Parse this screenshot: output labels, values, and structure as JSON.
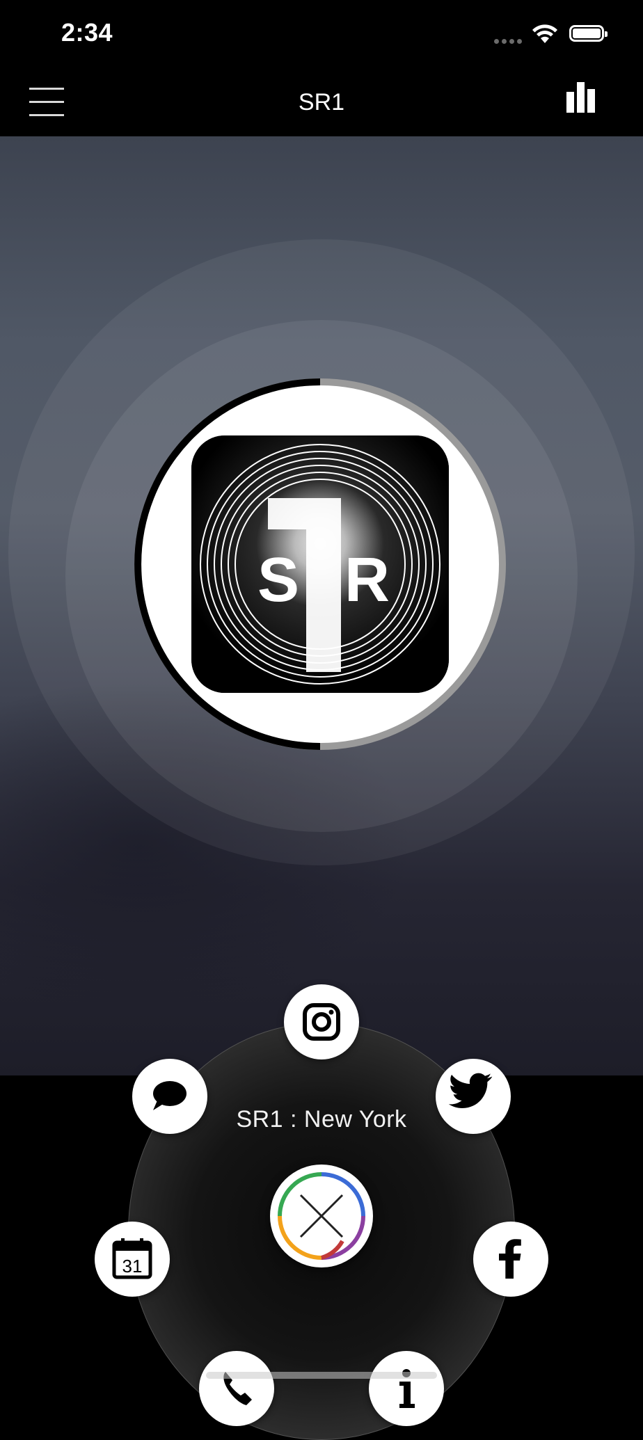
{
  "status_bar": {
    "time": "2:34",
    "icons": [
      "cellular-signal-icon",
      "wifi-icon",
      "battery-icon"
    ]
  },
  "nav": {
    "title": "SR1",
    "menu_icon": "hamburger-menu-icon",
    "stats_icon": "bar-chart-icon"
  },
  "player": {
    "logo_text_left": "S",
    "logo_text_center": "1",
    "logo_text_right": "R",
    "progress": 0.5
  },
  "bottom_panel": {
    "station_label": "SR1 : New York",
    "close_icon": "close-icon",
    "actions": [
      {
        "name": "instagram",
        "icon": "instagram-icon"
      },
      {
        "name": "twitter",
        "icon": "twitter-icon"
      },
      {
        "name": "chat",
        "icon": "chat-bubble-icon"
      },
      {
        "name": "facebook",
        "icon": "facebook-icon"
      },
      {
        "name": "calendar",
        "icon": "calendar-icon",
        "day": "31"
      },
      {
        "name": "phone",
        "icon": "phone-icon"
      },
      {
        "name": "info",
        "icon": "info-icon"
      }
    ]
  },
  "colors": {
    "background": "#000000",
    "accent_ring": [
      "#3b6bd6",
      "#36a852",
      "#f3a21b",
      "#c23a3a",
      "#8b3fa0"
    ]
  }
}
